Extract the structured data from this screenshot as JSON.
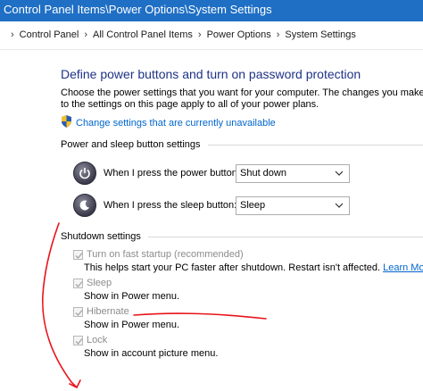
{
  "window": {
    "title": "Control Panel Items\\Power Options\\System Settings"
  },
  "breadcrumb": {
    "items": [
      "Control Panel",
      "All Control Panel Items",
      "Power Options",
      "System Settings"
    ],
    "separator": "›"
  },
  "page": {
    "heading": "Define power buttons and turn on password protection",
    "description": "Choose the power settings that you want for your computer. The changes you make to the settings on this page apply to all of your power plans.",
    "change_link": "Change settings that are currently unavailable"
  },
  "power_and_sleep": {
    "section_title": "Power and sleep button settings",
    "power_button": {
      "label": "When I press the power button:",
      "value": "Shut down"
    },
    "sleep_button": {
      "label": "When I press the sleep button:",
      "value": "Sleep"
    }
  },
  "shutdown": {
    "section_title": "Shutdown settings",
    "fast_startup": {
      "label": "Turn on fast startup (recommended)",
      "desc": "This helps start your PC faster after shutdown. Restart isn't affected.",
      "link": "Learn More",
      "checked": true
    },
    "sleep": {
      "label": "Sleep",
      "desc": "Show in Power menu.",
      "checked": true
    },
    "hibernate": {
      "label": "Hibernate",
      "desc": "Show in Power menu.",
      "checked": true
    },
    "lock": {
      "label": "Lock",
      "desc": "Show in account picture menu.",
      "checked": true
    }
  },
  "colors": {
    "titlebar": "#1f6fc5",
    "heading": "#1e3287",
    "link": "#0066cc",
    "annotation": "#e8141b",
    "disabled_text": "#8c8c8c"
  }
}
